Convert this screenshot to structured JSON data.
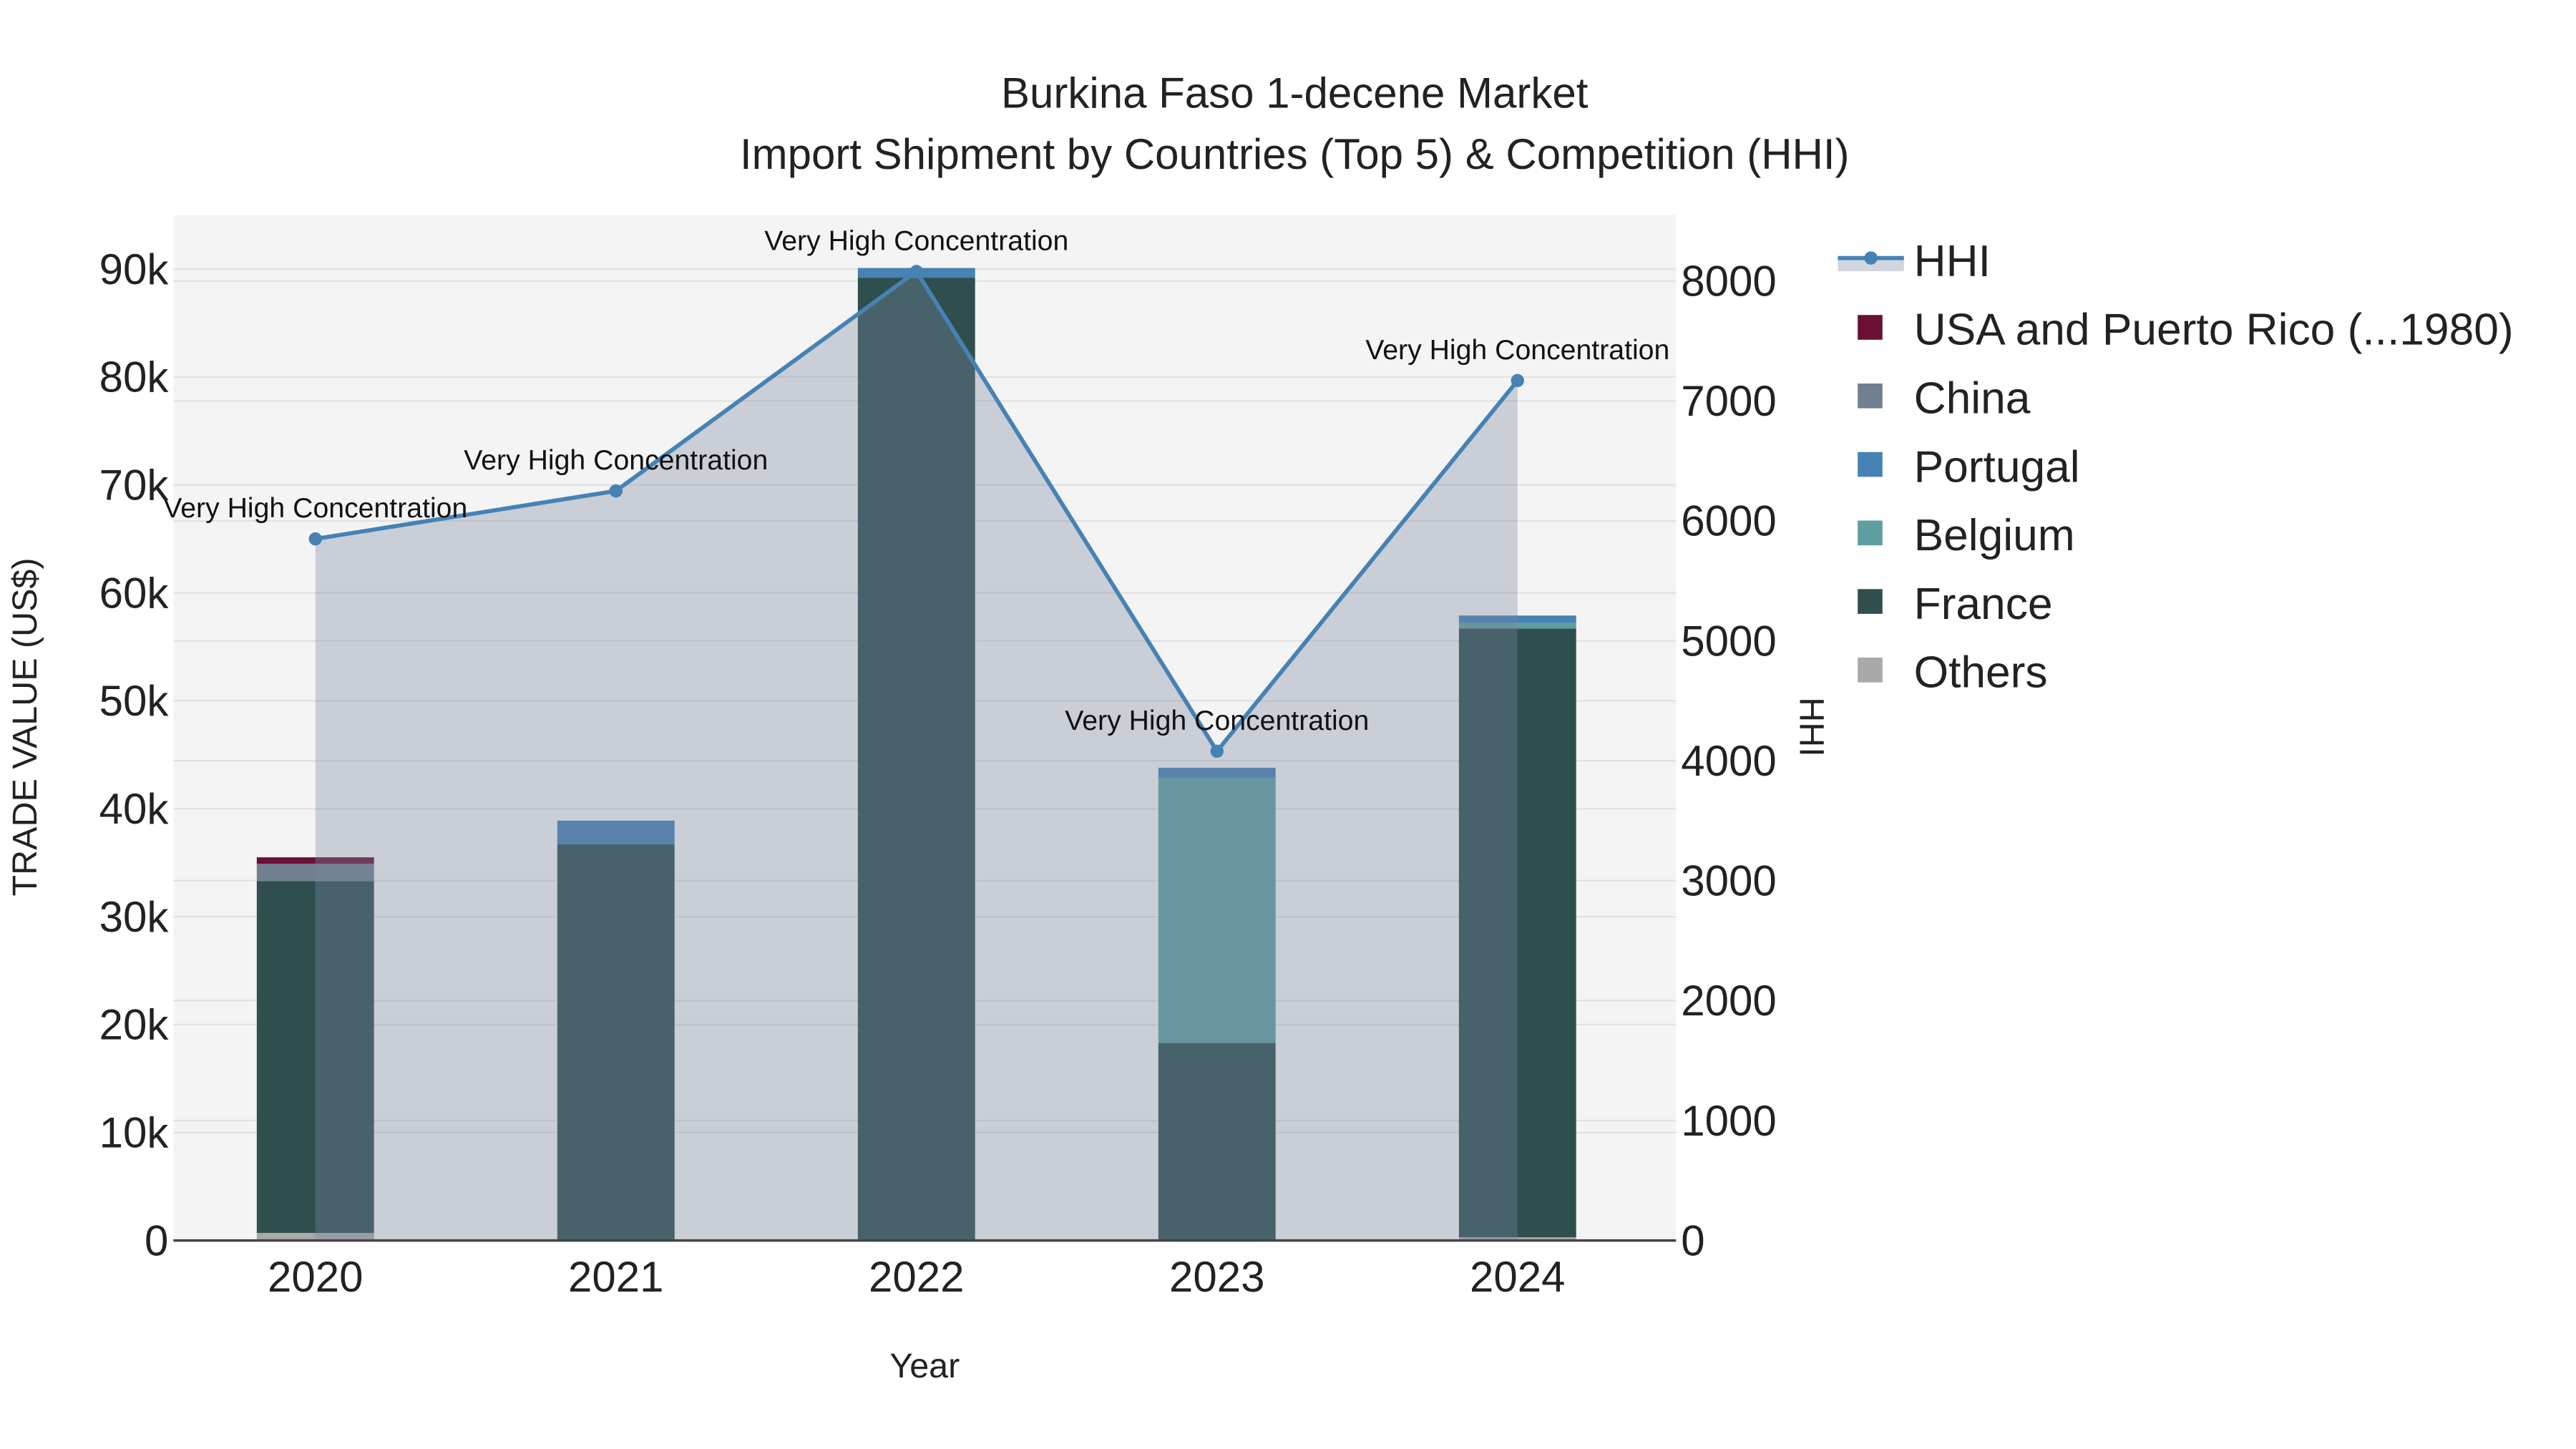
{
  "chart_data": {
    "type": "bar",
    "title": "Burkina Faso 1-decene Market",
    "subtitle": "Import Shipment by Countries (Top 5) & Competition (HHI)",
    "xlabel": "Year",
    "ylabel": "TRADE VALUE (US$)",
    "y2label": "HHI",
    "ylim": [
      0,
      95000
    ],
    "y2lim": [
      0,
      8550
    ],
    "yticks": [
      0,
      10000,
      20000,
      30000,
      40000,
      50000,
      60000,
      70000,
      80000,
      90000
    ],
    "ytick_labels": [
      "0",
      "10k",
      "20k",
      "30k",
      "40k",
      "50k",
      "60k",
      "70k",
      "80k",
      "90k"
    ],
    "y2ticks": [
      0,
      1000,
      2000,
      3000,
      4000,
      5000,
      6000,
      7000,
      8000
    ],
    "y2tick_labels": [
      "0",
      "1000",
      "2000",
      "3000",
      "4000",
      "5000",
      "6000",
      "7000",
      "8000"
    ],
    "categories": [
      "2020",
      "2021",
      "2022",
      "2023",
      "2024"
    ],
    "grid": true,
    "legend_placement": "right",
    "series": [
      {
        "name": "Others",
        "color": "#a9a9a9",
        "values": [
          700,
          0,
          0,
          0,
          300
        ]
      },
      {
        "name": "France",
        "color": "#2f4f4f",
        "values": [
          32600,
          36700,
          89200,
          18300,
          56400
        ]
      },
      {
        "name": "Belgium",
        "color": "#5f9ea0",
        "values": [
          0,
          0,
          0,
          24600,
          500
        ]
      },
      {
        "name": "Portugal",
        "color": "#4682b4",
        "values": [
          0,
          2200,
          900,
          900,
          700
        ]
      },
      {
        "name": "China",
        "color": "#708090",
        "values": [
          1600,
          0,
          0,
          0,
          0
        ]
      },
      {
        "name": "USA and Puerto Rico (...1980)",
        "color": "#6b1035",
        "values": [
          600,
          0,
          0,
          0,
          0
        ]
      }
    ],
    "hhi": {
      "name": "HHI",
      "color": "#4682b4",
      "values": [
        5850,
        6250,
        8080,
        4080,
        7170
      ],
      "annotations": [
        "Very High Concentration",
        "Very High Concentration",
        "Very High Concentration",
        "Very High Concentration",
        "Very High Concentration"
      ]
    },
    "legend": [
      "HHI",
      "USA and Puerto Rico (...1980)",
      "China",
      "Portugal",
      "Belgium",
      "France",
      "Others"
    ]
  }
}
